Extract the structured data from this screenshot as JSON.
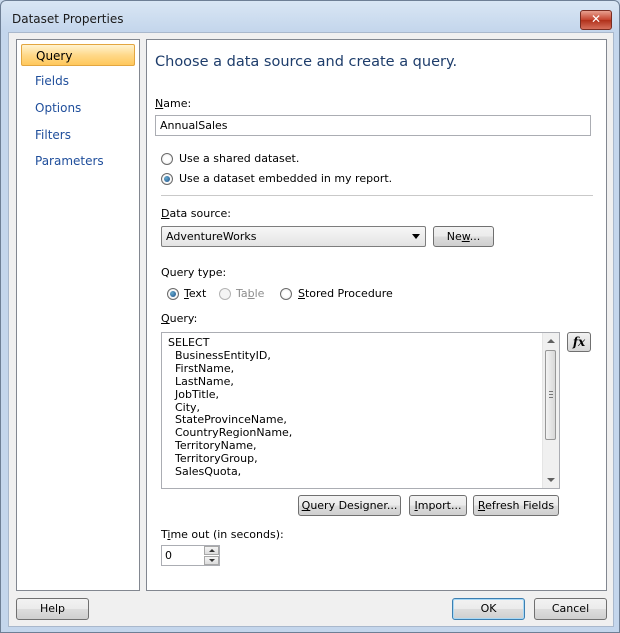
{
  "window": {
    "title": "Dataset Properties",
    "close_glyph": "✕"
  },
  "nav": {
    "items": [
      {
        "label": "Query",
        "active": true
      },
      {
        "label": "Fields",
        "active": false
      },
      {
        "label": "Options",
        "active": false
      },
      {
        "label": "Filters",
        "active": false
      },
      {
        "label": "Parameters",
        "active": false
      }
    ]
  },
  "main": {
    "heading": "Choose a data source and create a query.",
    "name": {
      "label_mn": "N",
      "label_rest": "ame:",
      "value": "AnnualSales"
    },
    "radio_shared": {
      "label": "Use a shared dataset.",
      "checked": false
    },
    "radio_embedded": {
      "label": "Use a dataset embedded in my report.",
      "checked": true
    },
    "data_source": {
      "label_mn": "D",
      "label_rest": "ata source:",
      "selected": "AdventureWorks",
      "new_btn_pre": "Ne",
      "new_btn_mn": "w",
      "new_btn_post": "..."
    },
    "query_type": {
      "label": "Query type:",
      "text": {
        "mn": "T",
        "rest": "ext",
        "checked": true
      },
      "table": {
        "pre": "Ta",
        "mn": "b",
        "post": "le",
        "disabled": true
      },
      "stored": {
        "mn": "S",
        "rest": "tored Procedure",
        "checked": false
      }
    },
    "query": {
      "label_mn": "Q",
      "label_rest": "uery:",
      "text": "SELECT\n  BusinessEntityID,\n  FirstName,\n  LastName,\n  JobTitle,\n  City,\n  StateProvinceName,\n  CountryRegionName,\n  TerritoryName,\n  TerritoryGroup,\n  SalesQuota,",
      "fx_label": "fx"
    },
    "buttons": {
      "query_designer": {
        "mn": "Q",
        "rest": "uery Designer..."
      },
      "import": {
        "mn": "I",
        "rest": "mport..."
      },
      "refresh": {
        "mn": "R",
        "rest": "efresh Fields"
      }
    },
    "timeout": {
      "label_pre": "T",
      "label_mn": "i",
      "label_rest": "me out (in seconds):",
      "value": "0"
    }
  },
  "footer": {
    "help": "Help",
    "ok": "OK",
    "cancel": "Cancel"
  }
}
